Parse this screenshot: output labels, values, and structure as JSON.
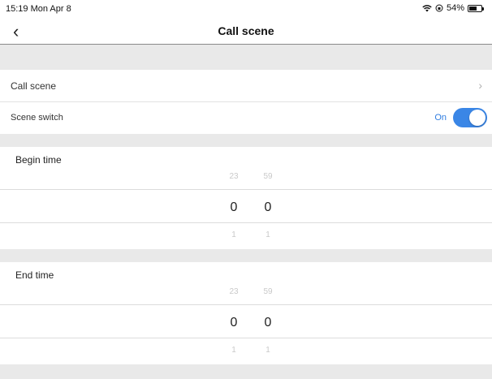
{
  "status": {
    "time": "15:19  Mon Apr 8",
    "battery": "54%"
  },
  "nav": {
    "back": "‹",
    "title": "Call scene"
  },
  "call_scene_row": {
    "label": "Call scene",
    "chevron": "›"
  },
  "scene_switch_row": {
    "label": "Scene switch",
    "state_text": "On"
  },
  "begin_time": {
    "label": "Begin time",
    "hour": {
      "above": "23",
      "selected": "0",
      "below": "1"
    },
    "minute": {
      "above": "59",
      "selected": "0",
      "below": "1"
    }
  },
  "end_time": {
    "label": "End time",
    "hour": {
      "above": "23",
      "selected": "0",
      "below": "1"
    },
    "minute": {
      "above": "59",
      "selected": "0",
      "below": "1"
    }
  }
}
